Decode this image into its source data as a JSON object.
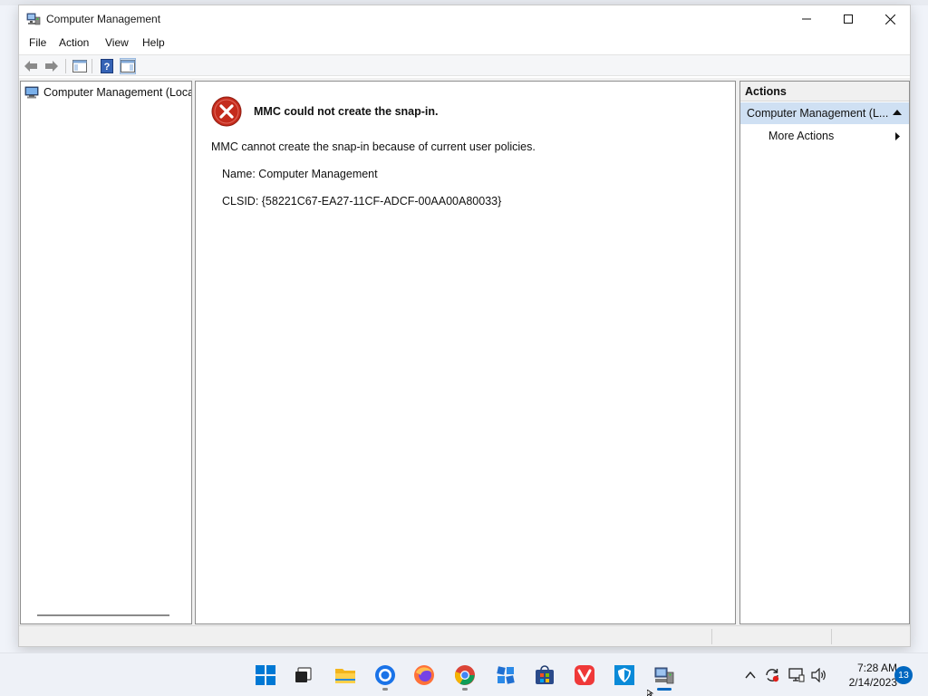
{
  "window": {
    "title": "Computer Management",
    "menu": [
      "File",
      "Action",
      "View",
      "Help"
    ]
  },
  "tree": {
    "root_label": "Computer Management (Local)"
  },
  "content": {
    "error_title": "MMC could not create the snap-in.",
    "error_message": "MMC cannot create the snap-in because of current user policies.",
    "name_line": "Name: Computer Management",
    "clsid_line": "CLSID: {58221C67-EA27-11CF-ADCF-00AA00A80033}"
  },
  "actions": {
    "header": "Actions",
    "group_label": "Computer Management (L...",
    "more_actions": "More Actions"
  },
  "taskbar": {
    "apps": [
      "start-icon",
      "task-view-icon",
      "file-explorer-icon",
      "browser-icon",
      "firefox-icon",
      "chrome-icon",
      "settings-app-icon",
      "store-icon",
      "vivaldi-icon",
      "security-icon",
      "computer-management-icon"
    ],
    "time": "7:28 AM",
    "date": "2/14/2023",
    "notification_count": "13"
  },
  "colors": {
    "accent": "#0067c0",
    "error_red": "#c42b1c",
    "actions_selected": "#cfe0f3"
  }
}
